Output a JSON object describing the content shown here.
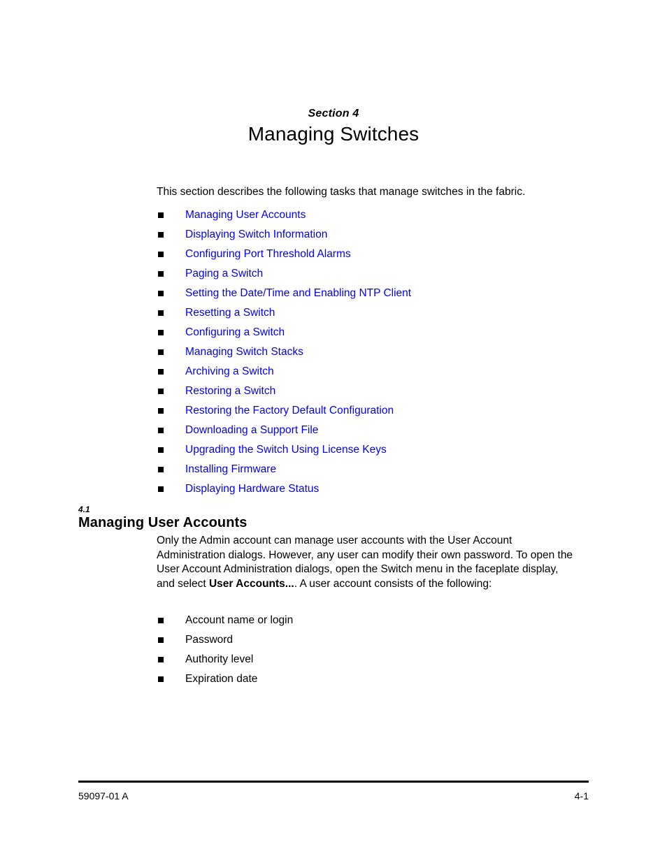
{
  "section": {
    "label": "Section 4",
    "title": "Managing Switches"
  },
  "intro": {
    "text": "This section describes the following tasks that manage switches in the fabric."
  },
  "task_links": [
    {
      "label": "Managing User Accounts"
    },
    {
      "label": "Displaying Switch Information"
    },
    {
      "label": "Configuring Port Threshold Alarms"
    },
    {
      "label": "Paging a Switch"
    },
    {
      "label": "Setting the Date/Time and Enabling NTP Client"
    },
    {
      "label": "Resetting a Switch"
    },
    {
      "label": "Configuring a Switch"
    },
    {
      "label": "Managing Switch Stacks"
    },
    {
      "label": "Archiving a Switch"
    },
    {
      "label": "Restoring a Switch"
    },
    {
      "label": "Restoring the Factory Default Configuration"
    },
    {
      "label": "Downloading a Support File"
    },
    {
      "label": "Upgrading the Switch Using License Keys"
    },
    {
      "label": "Installing Firmware"
    },
    {
      "label": "Displaying Hardware Status"
    }
  ],
  "subsection": {
    "number": "4.1",
    "title": "Managing User Accounts",
    "paragraph_part1": "Only the Admin account can manage user accounts with the User Account Administration dialogs. However, any user can modify their own password. To open the User Account Administration dialogs, open the Switch menu in the faceplate display, and select ",
    "paragraph_bold": "User Accounts...",
    "paragraph_part2": ". A user account consists of the following:"
  },
  "account_items": [
    {
      "label": "Account name or login"
    },
    {
      "label": "Password"
    },
    {
      "label": "Authority level"
    },
    {
      "label": "Expiration date"
    }
  ],
  "footer": {
    "doc_id": "59097-01 A",
    "page_number": "4-1"
  },
  "colors": {
    "link": "#0000ff",
    "text": "#000000",
    "background": "#ffffff"
  }
}
